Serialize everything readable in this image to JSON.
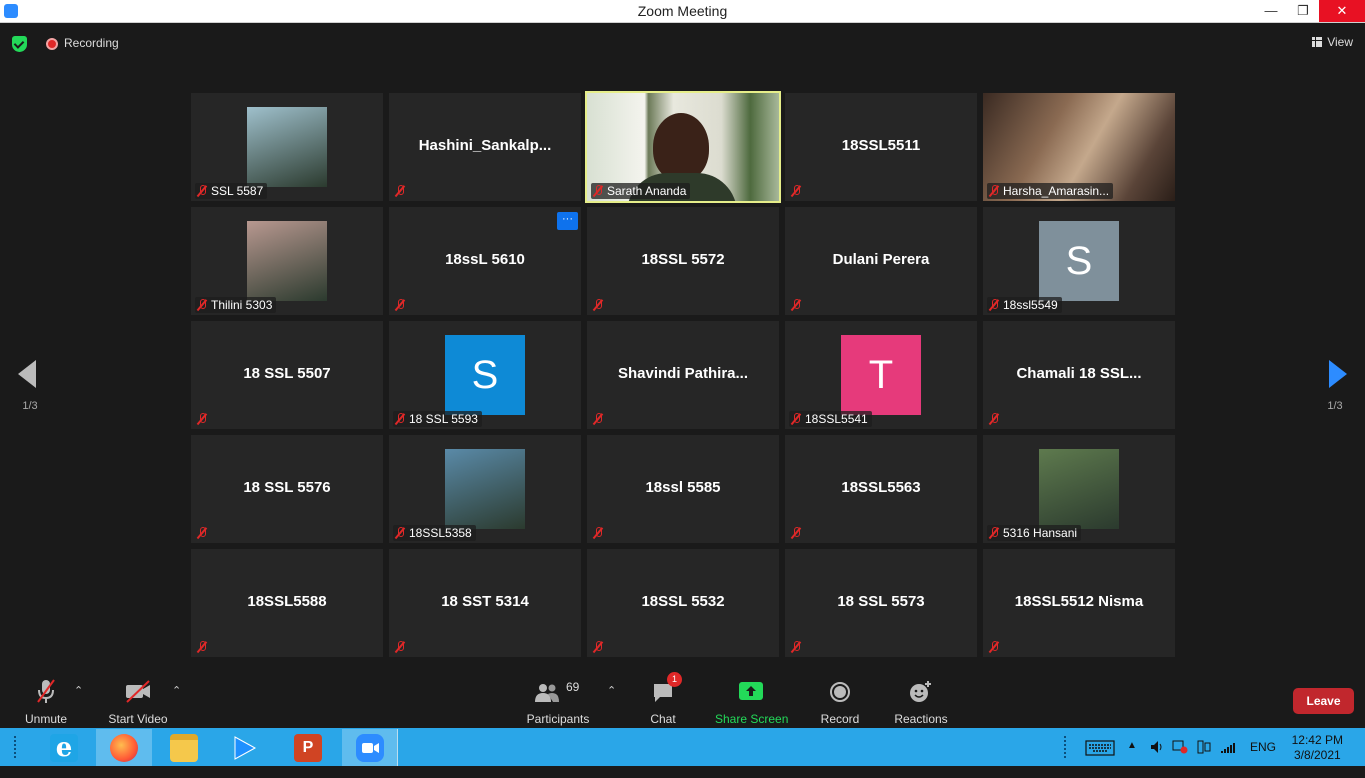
{
  "window": {
    "title": "Zoom Meeting"
  },
  "topbar": {
    "recording_label": "Recording",
    "view_label": "View"
  },
  "navigation": {
    "left_page": "1/3",
    "right_page": "1/3"
  },
  "participants": [
    {
      "name": "SSL 5587",
      "display": "photo",
      "photo_color": "#9fc0cc"
    },
    {
      "name": "Hashini_Sankalp...",
      "display": "text"
    },
    {
      "name": "Sarath Ananda",
      "display": "video",
      "active": true
    },
    {
      "name": "18SSL5511",
      "display": "text"
    },
    {
      "name": "Harsha_Amarasin...",
      "display": "video"
    },
    {
      "name": "Thilini 5303",
      "display": "photo",
      "photo_color": "#b89890"
    },
    {
      "name": "18ssL 5610",
      "display": "text",
      "more": "···"
    },
    {
      "name": "18SSL 5572",
      "display": "text"
    },
    {
      "name": "Dulani Perera",
      "display": "text"
    },
    {
      "name": "18ssl5549",
      "display": "letter",
      "letter": "S",
      "color": "#7f909b"
    },
    {
      "name": "18 SSL 5507",
      "display": "text"
    },
    {
      "name": "18 SSL 5593",
      "display": "letter",
      "letter": "S",
      "color": "#0e8ad6"
    },
    {
      "name": "Shavindi  Pathira...",
      "display": "text"
    },
    {
      "name": "18SSL5541",
      "display": "letter",
      "letter": "T",
      "color": "#e63a7b"
    },
    {
      "name": "Chamali  18  SSL...",
      "display": "text"
    },
    {
      "name": "18 SSL 5576",
      "display": "text"
    },
    {
      "name": "18SSL5358",
      "display": "photo",
      "photo_color": "#5a8aa8"
    },
    {
      "name": "18ssl 5585",
      "display": "text"
    },
    {
      "name": "18SSL5563",
      "display": "text"
    },
    {
      "name": "5316 Hansani",
      "display": "photo",
      "photo_color": "#5e7a4e"
    },
    {
      "name": "18SSL5588",
      "display": "text"
    },
    {
      "name": "18 SST 5314",
      "display": "text"
    },
    {
      "name": "18SSL 5532",
      "display": "text"
    },
    {
      "name": "18 SSL 5573",
      "display": "text"
    },
    {
      "name": "18SSL5512 Nisma",
      "display": "text"
    }
  ],
  "toolbar": {
    "unmute": "Unmute",
    "start_video": "Start Video",
    "participants": "Participants",
    "participant_count": "69",
    "chat": "Chat",
    "chat_badge": "1",
    "share_screen": "Share Screen",
    "record": "Record",
    "reactions": "Reactions",
    "leave": "Leave"
  },
  "taskbar": {
    "language": "ENG",
    "time": "12:42 PM",
    "date": "3/8/2021"
  },
  "colors": {
    "accent": "#2d8cff",
    "share_green": "#23d959",
    "leave_red": "#c1272d",
    "active_border": "#e6ee8a"
  }
}
